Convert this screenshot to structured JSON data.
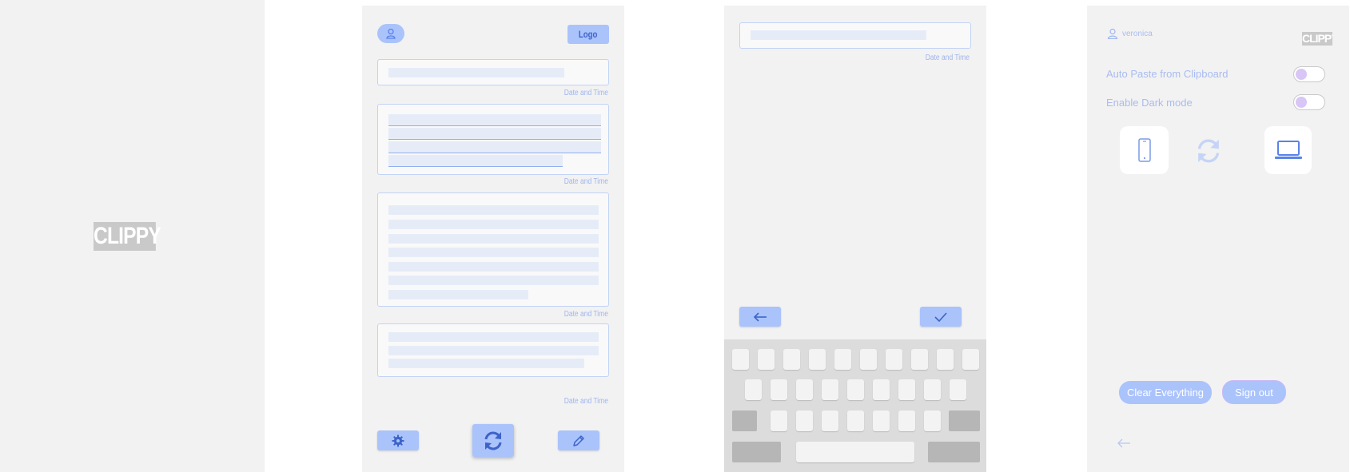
{
  "splash": {
    "logo": "CLIPPY"
  },
  "home": {
    "logo_button": "Logo",
    "entries": [
      {
        "timestamp": "Date and Time"
      },
      {
        "timestamp": "Date and Time"
      },
      {
        "timestamp": "Date and Time"
      },
      {
        "timestamp": "Date and Time"
      }
    ],
    "icons": {
      "profile": "user-icon",
      "settings": "gear-icon",
      "sync": "sync-icon",
      "edit": "pencil-icon"
    }
  },
  "edit": {
    "timestamp": "Date and Time",
    "icons": {
      "back": "arrow-left-icon",
      "confirm": "check-icon"
    }
  },
  "settings": {
    "username": "veronica",
    "logo": "CLIPPY",
    "auto_paste_label": "Auto Paste from Clipboard",
    "dark_mode_label": "Enable Dark mode",
    "auto_paste_on": false,
    "dark_mode_on": false,
    "clear_button": "Clear Everything",
    "signout_button": "Sign out",
    "icons": {
      "user": "user-icon",
      "phone": "phone-icon",
      "sync": "sync-icon",
      "laptop": "laptop-icon",
      "back": "arrow-left-icon"
    }
  },
  "colors": {
    "accent": "#aac3fb",
    "accent_dark": "#5a82e8",
    "panel": "#f2f2f2",
    "border": "#c2d3f5"
  }
}
